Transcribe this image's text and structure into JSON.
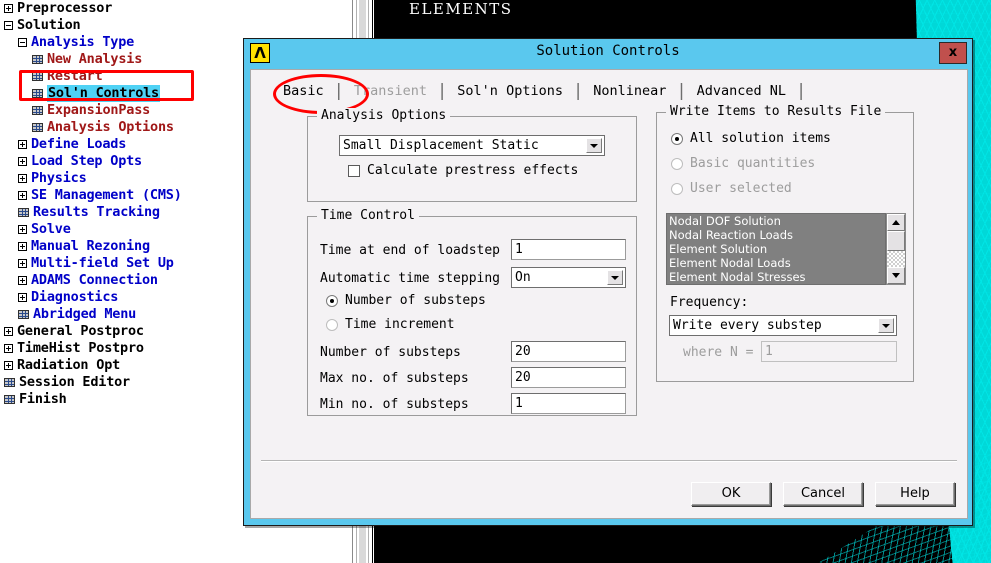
{
  "tree": {
    "items": [
      {
        "label": "Preprocessor",
        "indent": 0,
        "kind": "branch",
        "state": "collapsed",
        "style": "black"
      },
      {
        "label": "Solution",
        "indent": 0,
        "kind": "branch",
        "state": "expanded",
        "style": "black"
      },
      {
        "label": "Analysis Type",
        "indent": 1,
        "kind": "branch",
        "state": "expanded",
        "style": "blue"
      },
      {
        "label": "New Analysis",
        "indent": 2,
        "kind": "leaf",
        "state": "",
        "style": "red"
      },
      {
        "label": "Restart",
        "indent": 2,
        "kind": "leaf",
        "state": "",
        "style": "red"
      },
      {
        "label": "Sol'n Controls",
        "indent": 2,
        "kind": "leaf",
        "state": "",
        "style": "selected"
      },
      {
        "label": "ExpansionPass",
        "indent": 2,
        "kind": "leaf",
        "state": "",
        "style": "red"
      },
      {
        "label": "Analysis Options",
        "indent": 2,
        "kind": "leaf",
        "state": "",
        "style": "red"
      },
      {
        "label": "Define Loads",
        "indent": 1,
        "kind": "branch",
        "state": "collapsed",
        "style": "blue"
      },
      {
        "label": "Load Step Opts",
        "indent": 1,
        "kind": "branch",
        "state": "collapsed",
        "style": "blue"
      },
      {
        "label": "Physics",
        "indent": 1,
        "kind": "branch",
        "state": "collapsed",
        "style": "blue"
      },
      {
        "label": "SE Management (CMS)",
        "indent": 1,
        "kind": "branch",
        "state": "collapsed",
        "style": "blue"
      },
      {
        "label": "Results Tracking",
        "indent": 1,
        "kind": "leaf",
        "state": "",
        "style": "blue"
      },
      {
        "label": "Solve",
        "indent": 1,
        "kind": "branch",
        "state": "collapsed",
        "style": "blue"
      },
      {
        "label": "Manual Rezoning",
        "indent": 1,
        "kind": "branch",
        "state": "collapsed",
        "style": "blue"
      },
      {
        "label": "Multi-field Set Up",
        "indent": 1,
        "kind": "branch",
        "state": "collapsed",
        "style": "blue"
      },
      {
        "label": "ADAMS Connection",
        "indent": 1,
        "kind": "branch",
        "state": "collapsed",
        "style": "blue"
      },
      {
        "label": "Diagnostics",
        "indent": 1,
        "kind": "branch",
        "state": "collapsed",
        "style": "blue"
      },
      {
        "label": "Abridged Menu",
        "indent": 1,
        "kind": "leaf",
        "state": "",
        "style": "blue"
      },
      {
        "label": "General Postproc",
        "indent": 0,
        "kind": "branch",
        "state": "collapsed",
        "style": "black"
      },
      {
        "label": "TimeHist Postpro",
        "indent": 0,
        "kind": "branch",
        "state": "collapsed",
        "style": "black"
      },
      {
        "label": "Radiation Opt",
        "indent": 0,
        "kind": "branch",
        "state": "collapsed",
        "style": "black"
      },
      {
        "label": "Session Editor",
        "indent": 0,
        "kind": "leaf",
        "state": "",
        "style": "black"
      },
      {
        "label": "Finish",
        "indent": 0,
        "kind": "leaf",
        "state": "",
        "style": "black"
      }
    ]
  },
  "graphics": {
    "label": "ELEMENTS"
  },
  "dialog": {
    "title": "Solution Controls",
    "icon": "ansys-logo-icon",
    "icon_glyph": "Λ",
    "close_label": "x",
    "tabs": [
      {
        "label": "Basic",
        "state": "active"
      },
      {
        "label": "Transient",
        "state": "disabled"
      },
      {
        "label": "Sol'n Options",
        "state": "normal"
      },
      {
        "label": "Nonlinear",
        "state": "normal"
      },
      {
        "label": "Advanced NL",
        "state": "normal"
      }
    ],
    "analysis_options": {
      "legend": "Analysis Options",
      "analysis_type_value": "Small Displacement Static",
      "prestress_label": "Calculate prestress effects",
      "prestress_checked": false
    },
    "time_control": {
      "legend": "Time Control",
      "time_end_label": "Time at end of loadstep",
      "time_end_value": "1",
      "auto_step_label": "Automatic time stepping",
      "auto_step_value": "On",
      "radio_nsubsteps_label": "Number of substeps",
      "radio_timeinc_label": "Time increment",
      "radio_selected": "Number of substeps",
      "num_substeps_label": "Number of substeps",
      "num_substeps_value": "20",
      "max_substeps_label": "Max no. of substeps",
      "max_substeps_value": "20",
      "min_substeps_label": "Min no. of substeps",
      "min_substeps_value": "1"
    },
    "write_items": {
      "legend": "Write Items to Results File",
      "radios": [
        {
          "label": "All solution items",
          "selected": true,
          "enabled": true
        },
        {
          "label": "Basic quantities",
          "selected": false,
          "enabled": false
        },
        {
          "label": "User selected",
          "selected": false,
          "enabled": false
        }
      ],
      "list_items": [
        "Nodal DOF Solution",
        "Nodal Reaction Loads",
        "Element Solution",
        "Element Nodal Loads",
        "Element Nodal Stresses"
      ],
      "frequency_label": "Frequency:",
      "frequency_value": "Write every substep",
      "where_n_label": "where N =",
      "where_n_value": "1",
      "where_n_enabled": false
    },
    "buttons": [
      {
        "label": "OK"
      },
      {
        "label": "Cancel"
      },
      {
        "label": "Help"
      }
    ]
  },
  "colors": {
    "titlebar": "#5ac8ee",
    "dialog_face": "#f4f2f4",
    "selection": "#4fd2f5",
    "annotation": "#ff0000",
    "mesh": "#00d8d8",
    "tree_branch_blue": "#0000c8",
    "tree_leaf_red": "#a01818",
    "close_button": "#c0504d"
  }
}
